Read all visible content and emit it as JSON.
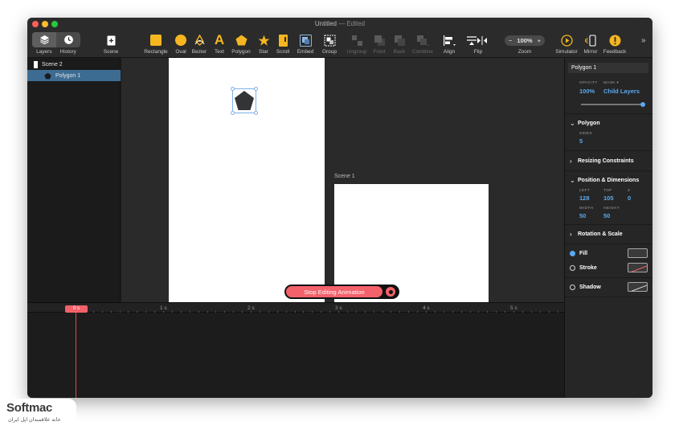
{
  "window": {
    "title": "Untitled",
    "title_suffix": "— Edited"
  },
  "toolbar": {
    "layers": "Layers",
    "history": "History",
    "scene": "Scene",
    "rectangle": "Rectangle",
    "oval": "Oval",
    "bezier": "Bezier",
    "text": "Text",
    "text_glyph": "A",
    "polygon": "Polygon",
    "star": "Star",
    "scroll": "Scroll",
    "embed": "Embed",
    "group": "Group",
    "ungroup": "Ungroup",
    "front": "Front",
    "back": "Back",
    "combine": "Combine",
    "align": "Align",
    "flip": "Flip",
    "zoom_label": "Zoom",
    "zoom_value": "100%",
    "zoom_minus": "−",
    "zoom_plus": "+",
    "simulator": "Simulator",
    "mirror": "Mirror",
    "feedback": "Feedback",
    "overflow": "»"
  },
  "layers": {
    "items": [
      {
        "label": "Scene 2"
      },
      {
        "label": "Polygon 1",
        "selected": true
      }
    ]
  },
  "canvas": {
    "artboard_label": "Scene 1",
    "stop_button": "Stop Editing Animation"
  },
  "inspector": {
    "name": "Polygon 1",
    "opacity_label": "OPACITY",
    "opacity_value": "100%",
    "mask_label": "MASK ▾",
    "mask_value": "Child Layers",
    "opacity_level": 1.0,
    "polygon_title": "Polygon",
    "sides_label": "SIDES",
    "sides_value": "5",
    "resizing_title": "Resizing Constraints",
    "position_title": "Position & Dimensions",
    "left_label": "LEFT",
    "left_value": "128",
    "top_label": "TOP",
    "top_value": "105",
    "z_label": "Z",
    "z_value": "0",
    "width_label": "WIDTH",
    "width_value": "50",
    "height_label": "HEIGHT",
    "height_value": "50",
    "rotation_title": "Rotation & Scale",
    "fill_label": "Fill",
    "stroke_label": "Stroke",
    "shadow_label": "Shadow",
    "chev_open": "⌄",
    "chev_closed": "›"
  },
  "timeline": {
    "playhead": "0 s",
    "ticks": [
      "1 s",
      "2 s",
      "3 s",
      "4 s",
      "5 s"
    ]
  },
  "watermark": {
    "name": "Softmac",
    "subtitle": "خانه علاقمندان اپل ایران"
  },
  "colors": {
    "accent_blue": "#5aa9f0",
    "selection": "#3d6c93",
    "tool_yellow": "#f5b620",
    "record_red": "#f3616a"
  }
}
